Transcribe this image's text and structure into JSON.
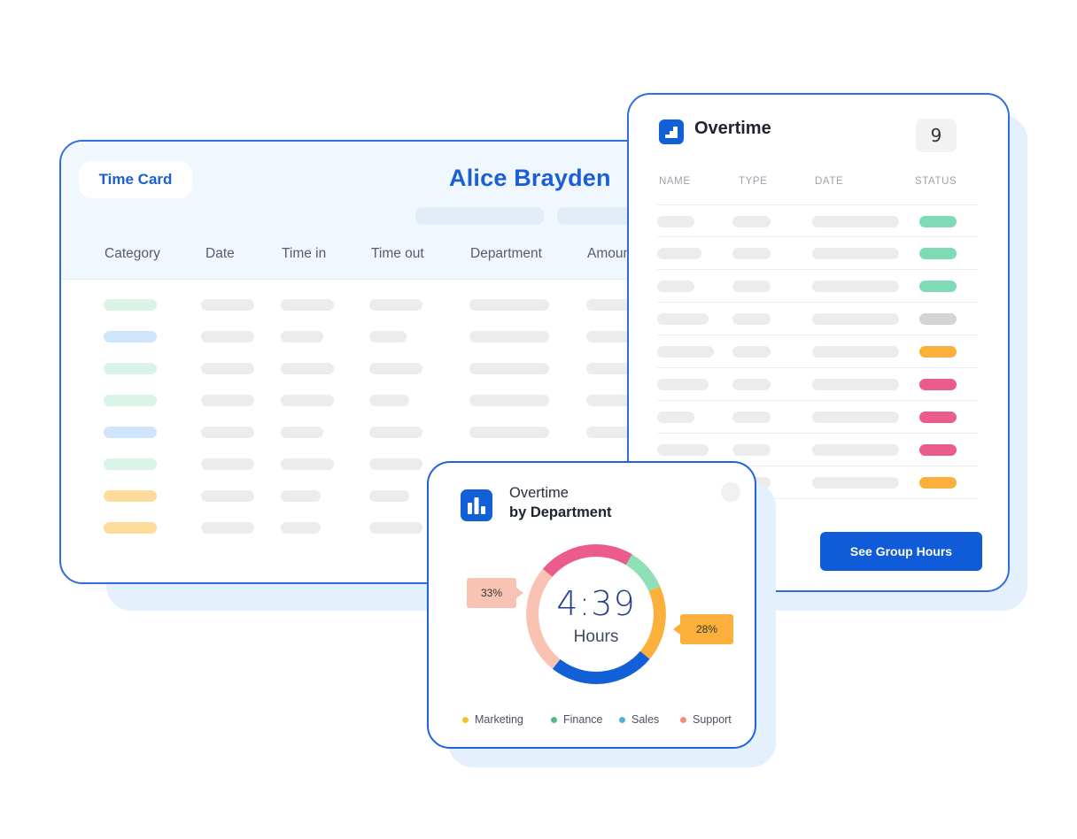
{
  "time_card": {
    "tab_label": "Time Card",
    "employee_name": "Alice Brayden",
    "columns": [
      "Category",
      "Date",
      "Time in",
      "Time out",
      "Department",
      "Amount"
    ]
  },
  "overtime_panel": {
    "title": "Overtime",
    "count": "9",
    "columns": [
      "NAME",
      "TYPE",
      "DATE",
      "STATUS"
    ],
    "status_colors": [
      "#7fdbb5",
      "#7fdbb5",
      "#7fdbb5",
      "#d4d4d4",
      "#fbb03b",
      "#eb5b8c",
      "#eb5b8c",
      "#eb5b8c",
      "#fbb03b"
    ],
    "button_label": "See Group Hours"
  },
  "department_panel": {
    "title_line1": "Overtime",
    "title_line2": "by Department",
    "total_value": "4:39",
    "total_unit": "Hours",
    "left_tag": "33%",
    "right_tag": "28%",
    "legend": [
      {
        "label": "Marketing",
        "color": "#f1c232"
      },
      {
        "label": "Finance",
        "color": "#52b88c"
      },
      {
        "label": "Sales",
        "color": "#4fb3d9"
      },
      {
        "label": "Support",
        "color": "#f28b7d"
      }
    ]
  },
  "colors": {
    "brand_blue": "#1160d8",
    "green": "#7fdbb5",
    "pink": "#eb5b8c",
    "orange": "#fbb03b",
    "peach": "#fac2b2"
  }
}
